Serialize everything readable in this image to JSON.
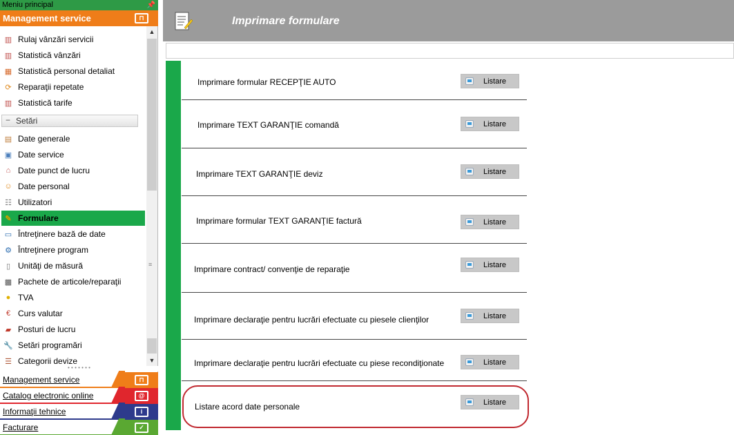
{
  "sidebar": {
    "panel_title": "Meniu principal",
    "header_label": "Management service",
    "partial_item": "Rulaj vânzări servicii",
    "items": [
      {
        "label": "Rulaj vânzări servicii",
        "icon": "chart-icon"
      },
      {
        "label": "Statistică vânzări",
        "icon": "chart-icon"
      },
      {
        "label": "Statistică personal detaliat",
        "icon": "chart-person-icon"
      },
      {
        "label": "Reparaţii repetate",
        "icon": "repeat-icon"
      },
      {
        "label": "Statistică tarife",
        "icon": "chart-icon"
      }
    ],
    "group_label": "Setări",
    "settings_items": [
      {
        "label": "Date generale",
        "icon": "document-icon"
      },
      {
        "label": "Date service",
        "icon": "building-icon"
      },
      {
        "label": "Date punct de lucru",
        "icon": "location-icon"
      },
      {
        "label": "Date personal",
        "icon": "person-icon"
      },
      {
        "label": "Utilizatori",
        "icon": "users-icon"
      },
      {
        "label": "Formulare",
        "icon": "form-edit-icon",
        "active": true
      },
      {
        "label": "Întreţinere bază de date",
        "icon": "database-icon"
      },
      {
        "label": "Întreţinere program",
        "icon": "maintenance-icon"
      },
      {
        "label": "Unităţi de măsură",
        "icon": "ruler-icon"
      },
      {
        "label": "Pachete de articole/reparaţii",
        "icon": "package-icon"
      },
      {
        "label": "TVA",
        "icon": "coin-icon"
      },
      {
        "label": "Curs valutar",
        "icon": "currency-icon"
      },
      {
        "label": "Posturi de lucru",
        "icon": "workstation-icon"
      },
      {
        "label": "Setări programări",
        "icon": "wrench-icon"
      },
      {
        "label": "Categorii devize",
        "icon": "list-icon"
      }
    ],
    "bottom_bars": [
      {
        "label": "Management service",
        "color": "#ef7d19",
        "logo": "service-logo-icon"
      },
      {
        "label": "Catalog electronic online",
        "color": "#e0262d",
        "logo": "at-icon"
      },
      {
        "label": "Informaţii tehnice",
        "color": "#2d3a8c",
        "logo": "info-icon"
      },
      {
        "label": "Facturare",
        "color": "#5aa832",
        "logo": "invoice-icon"
      }
    ]
  },
  "main": {
    "title": "Imprimare formulare",
    "button_label": "Listare",
    "rows": [
      {
        "label": "Imprimare formular RECEPŢIE AUTO"
      },
      {
        "label": "Imprimare TEXT GARANŢIE comandă"
      },
      {
        "label": "Imprimare TEXT GARANŢIE deviz"
      },
      {
        "label": "Imprimare formular TEXT GARANŢIE factură"
      },
      {
        "label": "Imprimare contract/ convenţie de reparaţie"
      },
      {
        "label": "Imprimare declaraţie pentru lucrări efectuate cu piesele clienţilor"
      },
      {
        "label": "Imprimare declaraţie pentru lucrări efectuate cu piese recondiţionate"
      },
      {
        "label": "Listare acord date personale",
        "highlighted": true
      }
    ]
  },
  "colors": {
    "accent_orange": "#ef7d19",
    "accent_green": "#1aa84a",
    "header_gray": "#9b9b9b",
    "highlight_red": "#c0282f"
  }
}
